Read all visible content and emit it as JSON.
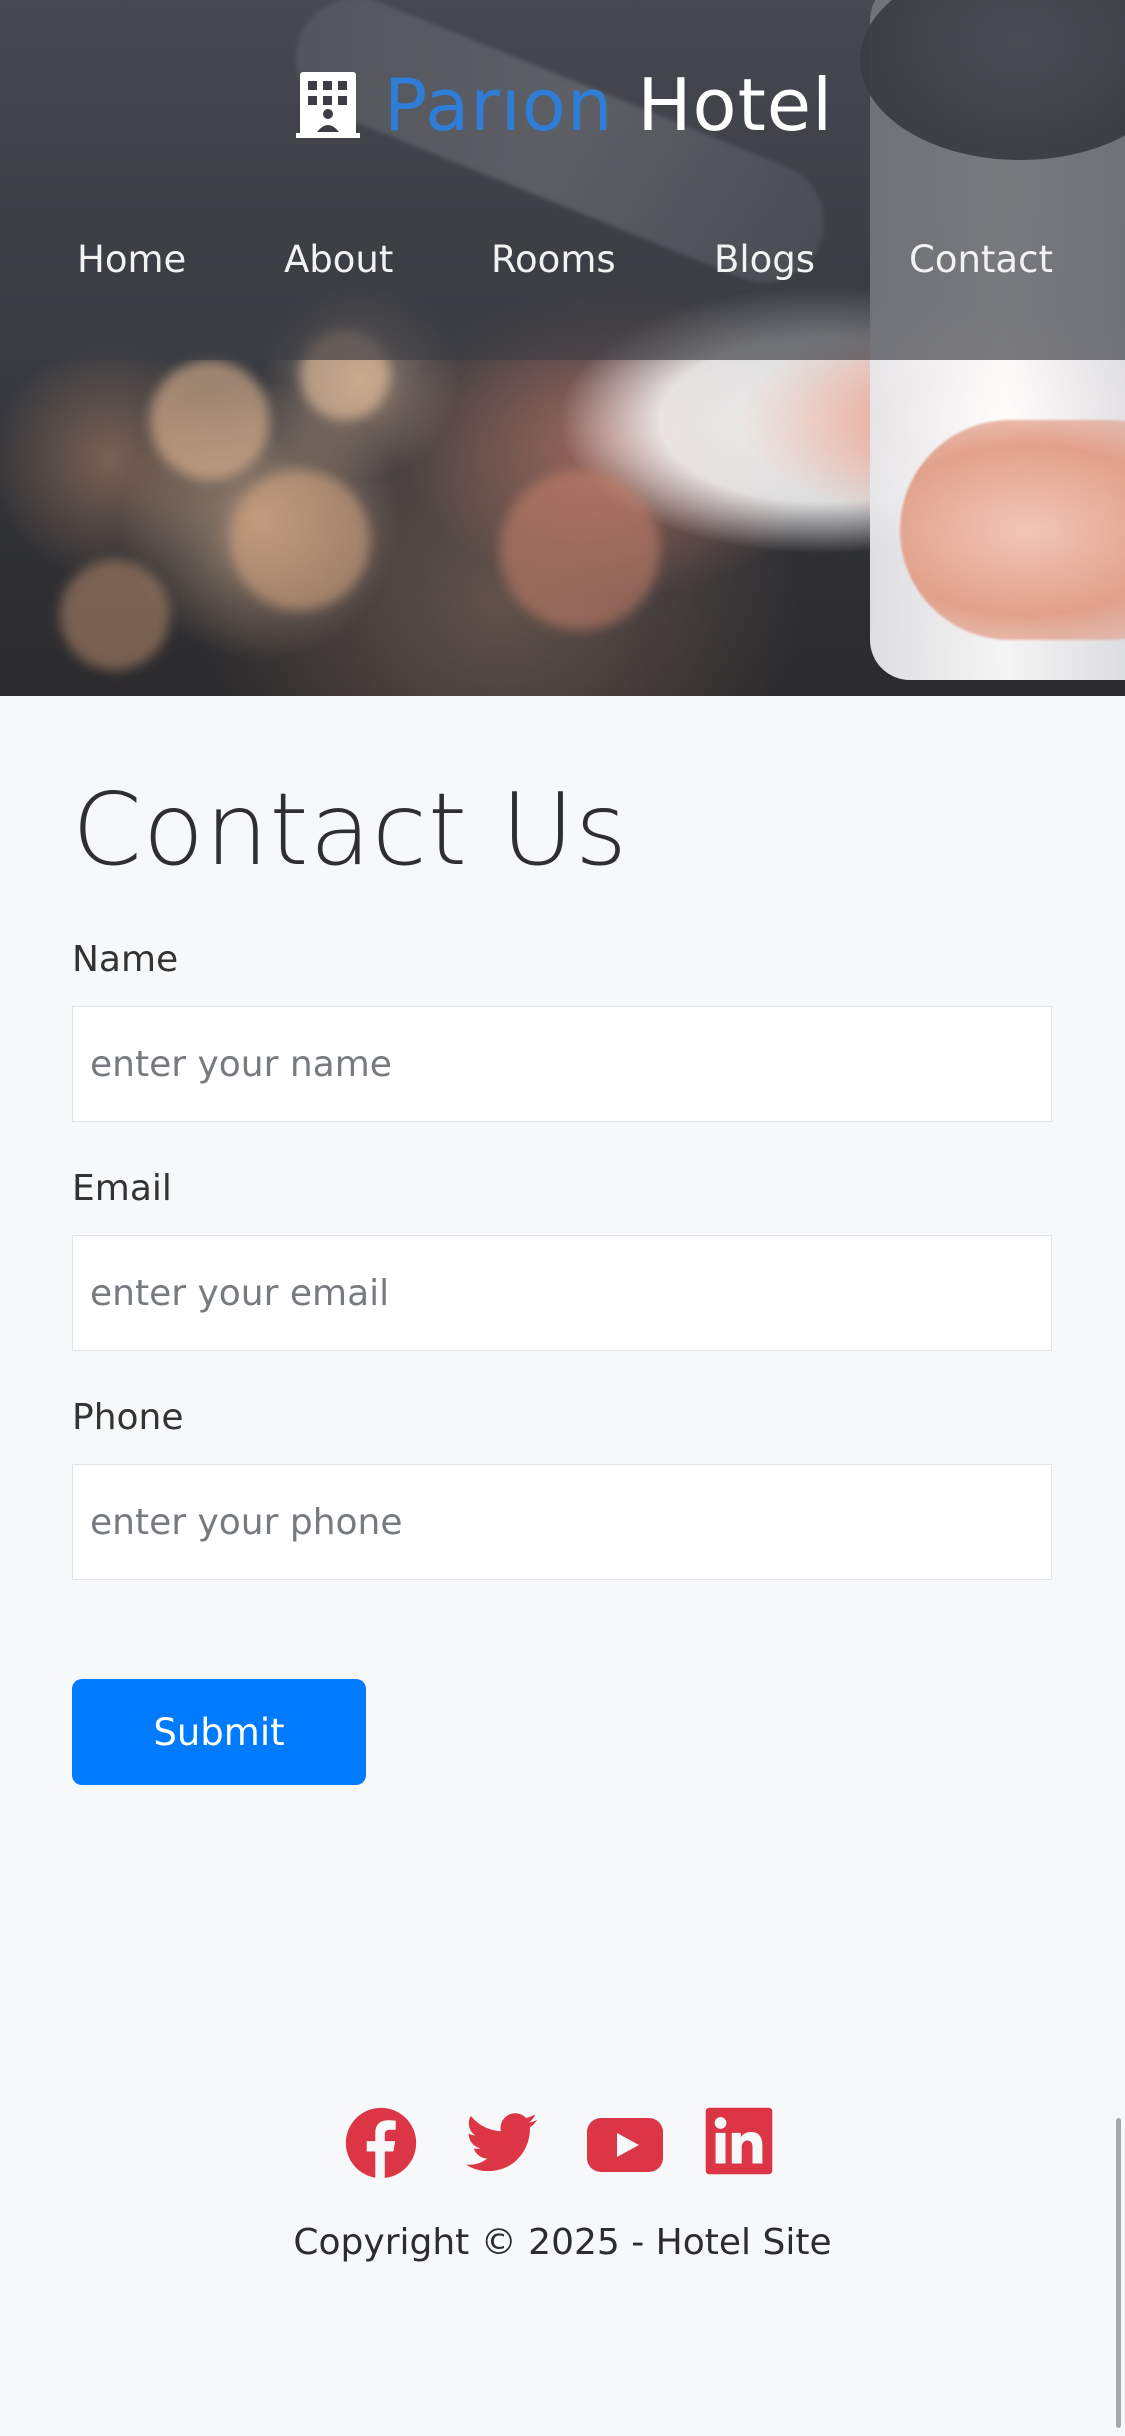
{
  "brand": {
    "name_part1": "Parıon",
    "name_part2": "Hotel",
    "icon": "building-icon"
  },
  "nav": {
    "items": [
      {
        "label": "Home"
      },
      {
        "label": "About"
      },
      {
        "label": "Rooms"
      },
      {
        "label": "Blogs"
      },
      {
        "label": "Contact"
      }
    ]
  },
  "main": {
    "title": "Contact Us",
    "fields": [
      {
        "label": "Name",
        "placeholder": "enter your name",
        "value": ""
      },
      {
        "label": "Email",
        "placeholder": "enter your email",
        "value": ""
      },
      {
        "label": "Phone",
        "placeholder": "enter your phone",
        "value": ""
      }
    ],
    "submit_label": "Submit"
  },
  "footer": {
    "social_icons": [
      "facebook-icon",
      "twitter-icon",
      "youtube-icon",
      "linkedin-icon"
    ],
    "copyright": "Copyright © 2025 - Hotel Site"
  },
  "colors": {
    "brand_accent": "#2e7dd6",
    "primary_button": "#007bff",
    "social_icon": "#dc3545"
  }
}
